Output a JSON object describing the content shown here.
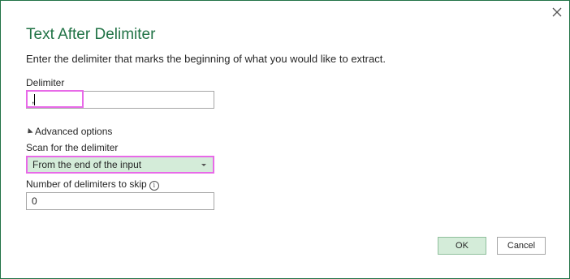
{
  "dialog": {
    "title": "Text After Delimiter",
    "description": "Enter the delimiter that marks the beginning of what you would like to extract.",
    "close_icon": "close-icon"
  },
  "delimiter": {
    "label": "Delimiter",
    "value": ","
  },
  "advanced": {
    "toggle_label": "Advanced options",
    "toggle_icon": "triangle-expanded-icon",
    "scan_label": "Scan for the delimiter",
    "scan_value": "From the end of the input",
    "skip_label": "Number of delimiters to skip",
    "skip_info_icon": "info-icon",
    "skip_value": "0"
  },
  "buttons": {
    "ok": "OK",
    "cancel": "Cancel"
  },
  "colors": {
    "accent": "#217346",
    "highlight": "#e86ae8",
    "selected_fill": "#d4ecd9"
  }
}
